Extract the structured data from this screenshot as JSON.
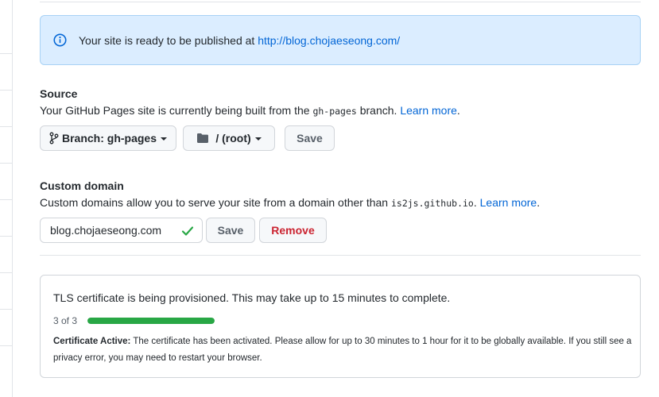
{
  "flash": {
    "message": "Your site is ready to be published at ",
    "url": "http://blog.chojaeseong.com/"
  },
  "source": {
    "title": "Source",
    "desc_prefix": "Your GitHub Pages site is currently being built from the ",
    "branch_code": "gh-pages",
    "desc_suffix": " branch. ",
    "learn_more": "Learn more",
    "desc_end": ".",
    "branch_button": "Branch: gh-pages",
    "folder_button": "/ (root)",
    "save_button": "Save"
  },
  "custom_domain": {
    "title": "Custom domain",
    "desc_prefix": "Custom domains allow you to serve your site from a domain other than ",
    "domain_code": "is2js.github.io",
    "desc_suffix": ". ",
    "learn_more": "Learn more",
    "desc_end": ".",
    "input_value": "blog.chojaeseong.com",
    "save_button": "Save",
    "remove_button": "Remove"
  },
  "tls": {
    "message": "TLS certificate is being provisioned. This may take up to 15 minutes to complete.",
    "step": "3 of 3",
    "progress": 1.0,
    "note_label": "Certificate Active:",
    "note_text": " The certificate has been activated. Please allow for up to 30 minutes to 1 hour for it to be globally available. If you still see a privacy error, you may need to restart your browser."
  },
  "colors": {
    "link": "#0366d6",
    "success": "#28a745",
    "danger": "#cb2431",
    "flash_bg": "#dbedff"
  },
  "icons": {
    "flash": "info-icon",
    "branch": "git-branch-icon",
    "folder": "folder-icon",
    "valid": "check-icon"
  }
}
